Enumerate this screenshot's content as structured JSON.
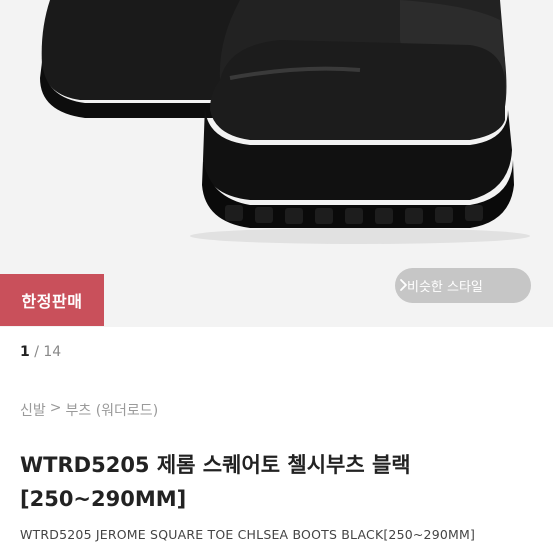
{
  "product_image": {
    "icon": "boots-photo"
  },
  "badge": {
    "label": "한정판매"
  },
  "similar_style": {
    "label": "비슷한 스타일",
    "icon": "chevron-right-icon"
  },
  "pager": {
    "current": "1",
    "separator": " / ",
    "total": "14"
  },
  "breadcrumb": {
    "items": [
      "신발",
      ">",
      "부츠 (워더로드)"
    ]
  },
  "product": {
    "title": "WTRD5205 제롬 스퀘어토 첼시부츠 블랙 [250~290MM]",
    "subtitle": "WTRD5205 JEROME SQUARE TOE CHLSEA BOOTS BLACK[250~290MM]"
  },
  "colors": {
    "badge": "#c9505b",
    "background": "#f3f3f3"
  }
}
